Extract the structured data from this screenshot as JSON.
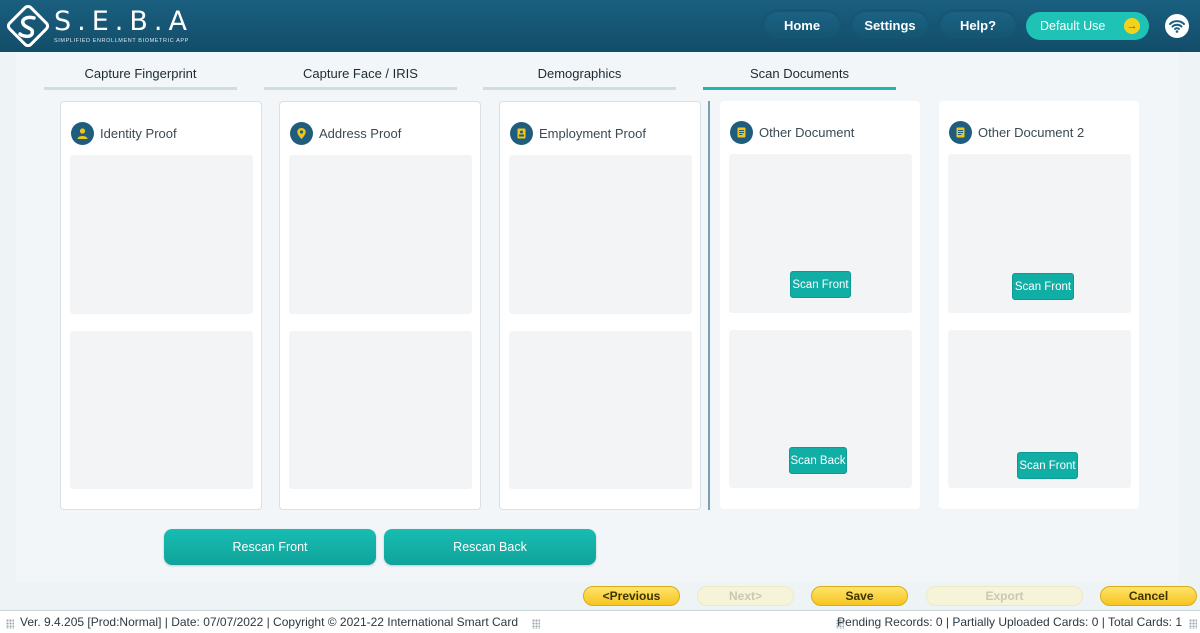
{
  "app": {
    "logo_text": "S.E.B.A",
    "logo_subtitle": "SIMPLIFIED ENROLLMENT BIOMETRIC APP"
  },
  "header": {
    "nav": {
      "home": "Home",
      "settings": "Settings",
      "help": "Help?"
    },
    "user_label": "Default Use",
    "user_dot": "→",
    "accent": "#1fc3b6"
  },
  "tabs": [
    {
      "label": "Capture Fingerprint",
      "active": false
    },
    {
      "label": "Capture Face / IRIS",
      "active": false
    },
    {
      "label": "Demographics",
      "active": false
    },
    {
      "label": "Scan Documents",
      "active": true
    }
  ],
  "cards": [
    {
      "title": "Identity Proof",
      "icon": "person-icon"
    },
    {
      "title": "Address Proof",
      "icon": "location-pin-icon"
    },
    {
      "title": "Employment Proof",
      "icon": "id-badge-icon"
    },
    {
      "title": "Other Document",
      "icon": "document-icon",
      "front_button": "Scan Front",
      "back_button": "Scan Back"
    },
    {
      "title": "Other Document 2",
      "icon": "document-icon",
      "front_button": "Scan Front",
      "back_button": "Scan Front"
    }
  ],
  "actions": {
    "rescan_front": "Rescan Front",
    "rescan_back": "Rescan Back"
  },
  "footer_buttons": {
    "previous": "<Previous",
    "next": "Next>",
    "save": "Save",
    "export": "Export",
    "cancel": "Cancel"
  },
  "status_bar": {
    "left": "Ver. 9.4.205 [Prod:Normal] | Date: 07/07/2022 | Copyright © 2021-22 International Smart Card",
    "right": "Pending Records: 0 | Partially Uploaded Cards: 0 | Total Cards: 1"
  }
}
